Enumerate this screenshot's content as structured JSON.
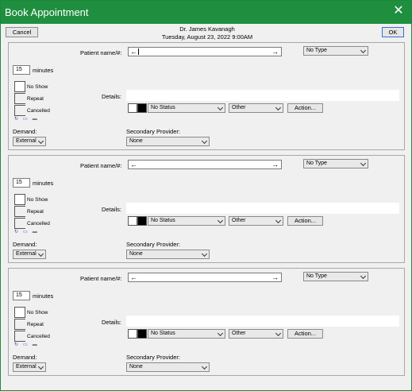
{
  "window": {
    "title": "Book Appointment"
  },
  "buttons": {
    "cancel": "Cancel",
    "ok": "OK"
  },
  "header": {
    "provider": "Dr. James Kavanagh",
    "date": "Tuesday, August 23, 2022 9:00AM"
  },
  "labels": {
    "patient": "Patient name/#:",
    "minutes": "minutes",
    "no_show": "No Show",
    "repeat": "Repeat",
    "cancelled": "Cancelled",
    "details": "Details:",
    "demand": "Demand:",
    "secondary_provider": "Secondary Provider:",
    "action": "Action..."
  },
  "slots": [
    {
      "minutes": "15",
      "type": "No Type",
      "status": "No Status",
      "category": "Other",
      "demand": "External",
      "secondary": "None",
      "cursor": true
    },
    {
      "minutes": "15",
      "type": "No Type",
      "status": "No Status",
      "category": "Other",
      "demand": "External",
      "secondary": "None",
      "cursor": false
    },
    {
      "minutes": "15",
      "type": "No Type",
      "status": "No Status",
      "category": "Other",
      "demand": "External",
      "secondary": "None",
      "cursor": false
    }
  ],
  "icons": [
    "recurrence-icon",
    "link-icon",
    "card-icon",
    "close-icon",
    "left-arrow-icon",
    "right-arrow-icon",
    "chevron-down-icon"
  ]
}
